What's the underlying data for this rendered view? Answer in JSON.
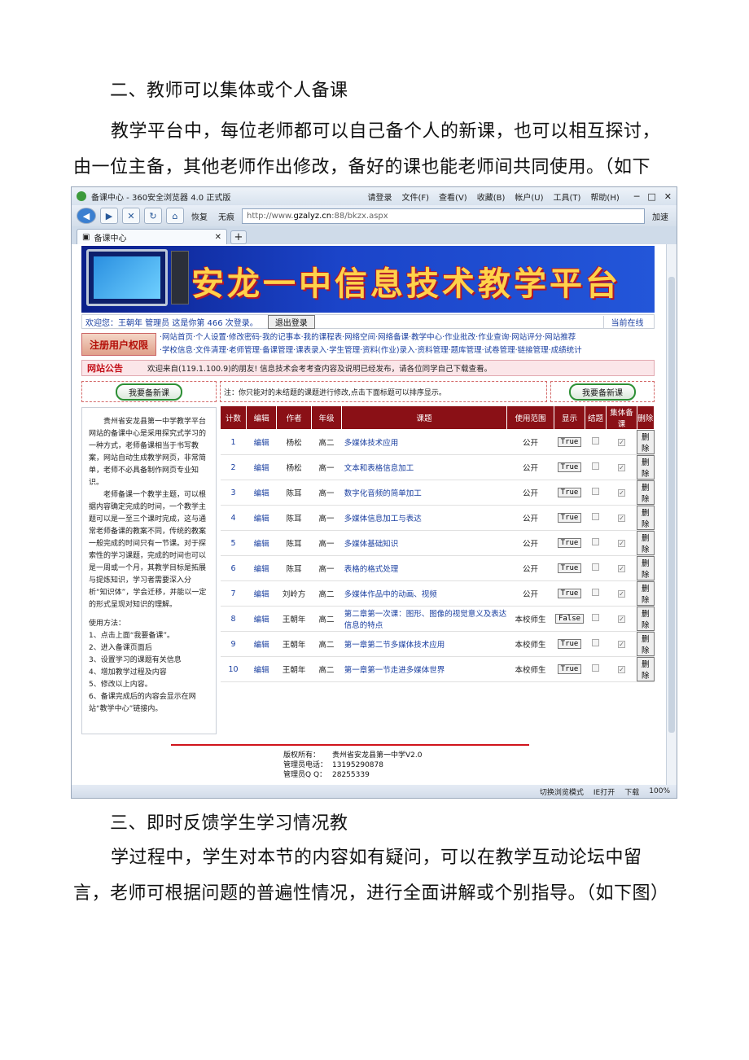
{
  "doc": {
    "p1": "二、教师可以集体或个人备课",
    "p2": "教学平台中，每位老师都可以自己备个人的新课，也可以相互探讨，由一位主备，其他老师作出修改，备好的课也能老师间共同使用。（如下图）",
    "p3": "三、即时反馈学生学习情况教",
    "p4": "学过程中，学生对本节的内容如有疑问，可以在教学互动论坛中留言，老师可根据问题的普遍性情况，进行全面讲解或个别指导。（如下图）"
  },
  "browser": {
    "title": "备课中心 - 360安全浏览器 4.0 正式版",
    "menus": [
      "请登录",
      "文件(F)",
      "查看(V)",
      "收藏(B)",
      "帐户(U)",
      "工具(T)",
      "帮助(H)"
    ],
    "restore_label": "恢复",
    "no_trace_label": "无痕",
    "url_prefix": "http://www.",
    "url_host": "gzalyz.cn",
    "url_path": ":88/bkzx.aspx",
    "accelerate": "加速",
    "tab_label": "备课中心",
    "status": [
      "切换浏览模式",
      "IE打开",
      "下载",
      "100%"
    ]
  },
  "site": {
    "banner_title": "安龙一中信息技术教学平台",
    "welcome": "欢迎您：王朝年  管理员  这是你第 466 次登录。",
    "logout": "退出登录",
    "online": "当前在线",
    "rights_badge": "注册用户权限",
    "nav_line1": "·网站首页·个人设置·修改密码·我的记事本·我的课程表·网络空间·网络备课·教学中心·作业批改·作业查询·网站评分·网站推荐",
    "nav_line2": "·学校信息·文件清理·老师管理·备课管理·课表录入·学生管理·资料(作业)录入·资料管理·题库管理·试卷管理·链接管理·成绩统计",
    "notice_title": "网站公告",
    "notice_text": "欢迎来自(119.1.100.9)的朋友! 信息技术会考考查内容及说明已经发布，请各位同学自己下载查看。",
    "new_lesson": "我要备新课",
    "table_note": "注：你只能对的未结题的课题进行修改,点击下面标题可以排序显示。",
    "left_p1": "贵州省安龙县第一中学教学平台 网站的备课中心是采用探究式学习的一种方式，老师备课相当于书写教案，网站自动生成教学网页，非常简单，老师不必具备制作网页专业知识。",
    "left_p2": "老师备课一个教学主题，可以根据内容确定完成的时间，一个教学主题可以是一至三个课时完成，这与通常老师备课的教案不同，传统的教案一般完成的时间只有一节课。对于探索性的学习课题，完成的时间也可以是一周或一个月，其教学目标是拓展与提炼知识，学习者需要深入分析“知识体”，学会迁移，并能以一定的形式呈现对知识的理解。",
    "usage_title": "使用方法：",
    "usage": [
      "1、点击上面“我要备课”。",
      "2、进入备课页面后",
      "3、设置学习的课题有关信息",
      "4、增加教学过程及内容",
      "5、修改以上内容。",
      "6、备课完成后的内容会显示在网站“教学中心”链接内。"
    ],
    "columns": [
      "计数",
      "编辑",
      "作者",
      "年级",
      "课题",
      "使用范围",
      "显示",
      "结题",
      "集体备课",
      "删除"
    ],
    "rows": [
      [
        "1",
        "编辑",
        "杨松",
        "高二",
        "多媒体技术应用",
        "公开",
        "True"
      ],
      [
        "2",
        "编辑",
        "杨松",
        "高一",
        "文本和表格信息加工",
        "公开",
        "True"
      ],
      [
        "3",
        "编辑",
        "陈耳",
        "高一",
        "数字化音频的简单加工",
        "公开",
        "True"
      ],
      [
        "4",
        "编辑",
        "陈耳",
        "高一",
        "多媒体信息加工与表达",
        "公开",
        "True"
      ],
      [
        "5",
        "编辑",
        "陈耳",
        "高一",
        "多媒体基础知识",
        "公开",
        "True"
      ],
      [
        "6",
        "编辑",
        "陈耳",
        "高一",
        "表格的格式处理",
        "公开",
        "True"
      ],
      [
        "7",
        "编辑",
        "刘岭方",
        "高二",
        "多媒体作品中的动画、视频",
        "公开",
        "True"
      ],
      [
        "8",
        "编辑",
        "王朝年",
        "高二",
        "第二章第一次课：图形、图像的视觉意义及表达信息的特点",
        "本校师生",
        "False"
      ],
      [
        "9",
        "编辑",
        "王朝年",
        "高二",
        "第一章第二节多媒体技术应用",
        "本校师生",
        "True"
      ],
      [
        "10",
        "编辑",
        "王朝年",
        "高二",
        "第一章第一节走进多媒体世界",
        "本校师生",
        "True"
      ]
    ],
    "delete_label": "删除",
    "footer_copyright_label": "版权所有：",
    "footer_copyright": "贵州省安龙县第一中学V2.0",
    "footer_phone_label": "管理员电话：",
    "footer_phone": "13195290878",
    "footer_qq_label": "管理员Q Q：",
    "footer_qq": "28255339"
  }
}
